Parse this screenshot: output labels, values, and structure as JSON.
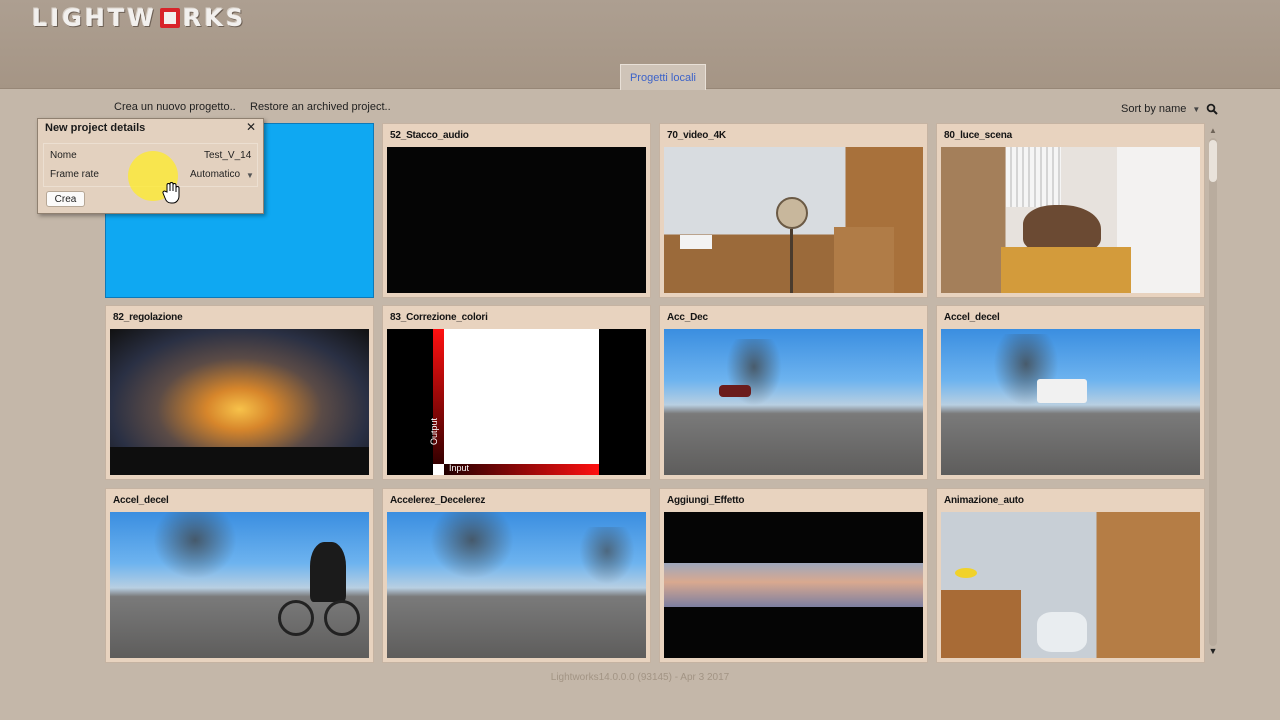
{
  "app": {
    "logo": "LIGHTWORKS",
    "logo_pre": "LIGHTW",
    "logo_post": "RKS"
  },
  "tabs": [
    {
      "label": "Progetti locali",
      "active": true
    }
  ],
  "toolbar": {
    "new_project": "Crea un nuovo progetto..",
    "restore": "Restore an archived project..",
    "sort_label": "Sort by name",
    "search_icon": "search-icon"
  },
  "dialog": {
    "title": "New project details",
    "close_icon": "close-icon",
    "fields": [
      {
        "label": "Nome",
        "value": "Test_V_14"
      },
      {
        "label": "Frame rate",
        "value": "Automatico"
      }
    ],
    "create_button": "Crea"
  },
  "projects": [
    {
      "title": "",
      "thumb": "blue",
      "selected": true
    },
    {
      "title": "52_Stacco_audio",
      "thumb": "black"
    },
    {
      "title": "70_video_4K",
      "thumb": "room"
    },
    {
      "title": "80_luce_scena",
      "thumb": "cat"
    },
    {
      "title": "82_regolazione",
      "thumb": "sunset"
    },
    {
      "title": "83_Correzione_colori",
      "thumb": "curves",
      "curve_input": "Input",
      "curve_output": "Output"
    },
    {
      "title": "Acc_Dec",
      "thumb": "street"
    },
    {
      "title": "Accel_decel",
      "thumb": "street"
    },
    {
      "title": "Accel_decel",
      "thumb": "street-bike"
    },
    {
      "title": "Accelerez_Decelerez",
      "thumb": "street"
    },
    {
      "title": "Aggiungi_Effetto",
      "thumb": "sky"
    },
    {
      "title": "Animazione_auto",
      "thumb": "room3"
    }
  ],
  "footer": {
    "version": "Lightworks14.0.0.0 (93145) - Apr  3 2017"
  },
  "colors": {
    "accent": "#0fa8f2",
    "tab_text": "#3d63c9",
    "logo_red": "#d8242a"
  }
}
